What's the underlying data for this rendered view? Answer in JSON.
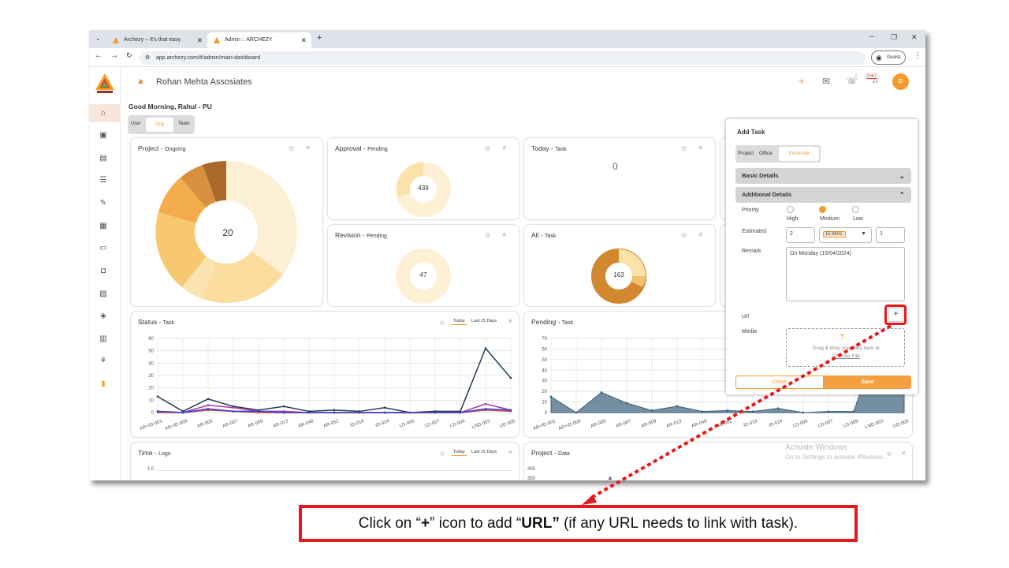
{
  "browser": {
    "tabs": [
      {
        "label": "Archezy – It's that easy"
      },
      {
        "label": "Admin :: ARCHEZY"
      }
    ],
    "url": "app.archezy.com/#/admin/main-dashboard",
    "profile": "Guest"
  },
  "header": {
    "company": "Rohan Mehta Assosiates",
    "notif_count": "0",
    "bell_count": "2067",
    "avatar": "R"
  },
  "greeting": "Good Morning, Rahul - PU",
  "view_toggle": [
    "User",
    "Org",
    "Team"
  ],
  "cards": {
    "project": {
      "title": "Project",
      "sub": "Ongoing",
      "center": "20"
    },
    "approval": {
      "title": "Approval",
      "sub": "Pending",
      "center": "439"
    },
    "today": {
      "title": "Today",
      "sub": "Task",
      "value": "0"
    },
    "revision": {
      "title": "Revision",
      "sub": "Pending",
      "center": "47"
    },
    "all": {
      "title": "All",
      "sub": "Task",
      "center": "163"
    },
    "status": {
      "title": "Status",
      "sub": "Task",
      "btn1": "Today",
      "btn2": "Last 15 Days"
    },
    "pending": {
      "title": "Pending",
      "sub": "Task"
    },
    "time": {
      "title": "Time",
      "sub": "Logs",
      "btn1": "Today",
      "btn2": "Last 15 Days",
      "ytop": "1.0"
    },
    "projectdata": {
      "title": "Project",
      "sub": "Data",
      "y1": "400",
      "y2": "350"
    }
  },
  "chart_data": [
    {
      "type": "line",
      "title": "Status - Task",
      "categories": [
        "AR+ID-001",
        "AR+ID-009",
        "AR-005",
        "AR-007",
        "AR-009",
        "AR-013",
        "AR-048",
        "AR-052",
        "ID-019",
        "ID-024",
        "LD-006",
        "LD-007",
        "LD-008",
        "LND-003",
        "UD-005"
      ],
      "yticks": [
        "60",
        "50",
        "40",
        "30",
        "20",
        "10",
        "0"
      ],
      "ylim": [
        0,
        60
      ],
      "series": [
        {
          "color": "#1e3a5a",
          "values": [
            13,
            1,
            11,
            5,
            2,
            5,
            1,
            2,
            1,
            4,
            0,
            1,
            1,
            52,
            28
          ]
        },
        {
          "color": "#a33aa3",
          "values": [
            1,
            0,
            6,
            4,
            1,
            1,
            0,
            0,
            0,
            0,
            0,
            0,
            0,
            7,
            2
          ]
        },
        {
          "color": "#d24a4a",
          "values": [
            0,
            0,
            2,
            1,
            0,
            0,
            0,
            0,
            0,
            0,
            0,
            0,
            0,
            2,
            1
          ]
        },
        {
          "color": "#3a3ad2",
          "values": [
            1,
            0,
            3,
            1,
            1,
            0,
            0,
            0,
            0,
            0,
            0,
            0,
            0,
            3,
            2
          ]
        }
      ]
    },
    {
      "type": "area",
      "title": "Pending - Task",
      "categories": [
        "AR+ID-001",
        "AR+ID-009",
        "AR-005",
        "AR-007",
        "AR-009",
        "AR-013",
        "AR-048",
        "AR-052",
        "ID-019",
        "ID-024",
        "LD-006",
        "LD-007",
        "LD-008",
        "LND-003",
        "UD-005"
      ],
      "yticks": [
        "70",
        "60",
        "50",
        "40",
        "30",
        "20",
        "10",
        "0"
      ],
      "ylim": [
        0,
        70
      ],
      "series": [
        {
          "color": "#3a5f7a",
          "values": [
            15,
            0,
            19,
            9,
            2,
            6,
            1,
            2,
            1,
            4,
            0,
            1,
            1,
            70,
            70
          ]
        }
      ]
    }
  ],
  "panel": {
    "title": "Add Task",
    "type_tabs": [
      "Project",
      "Office",
      "Personal"
    ],
    "basic": "Basic Details",
    "additional": "Additional Details",
    "priority_label": "Priority",
    "priorities": [
      "High",
      "Medium",
      "Low"
    ],
    "estimated_label": "Estimated",
    "est_value": "2",
    "est_unit": "15 Mins.",
    "est_count": "1",
    "remark_label": "Remark",
    "remark": "On Monday (15/04/2024)",
    "url_label": "Url",
    "media_label": "Media",
    "drop_text": "Drag & drop your files here or",
    "choose": "Choose File",
    "close": "Close",
    "save": "Save"
  },
  "watermark": {
    "line1": "Activate Windows",
    "line2": "Go to Settings to activate Windows."
  },
  "callout": {
    "pre": "Click on “",
    "plus": "+",
    "mid": "” icon to add “",
    "url": "URL”",
    "post": " (if any URL needs to link with task)."
  }
}
